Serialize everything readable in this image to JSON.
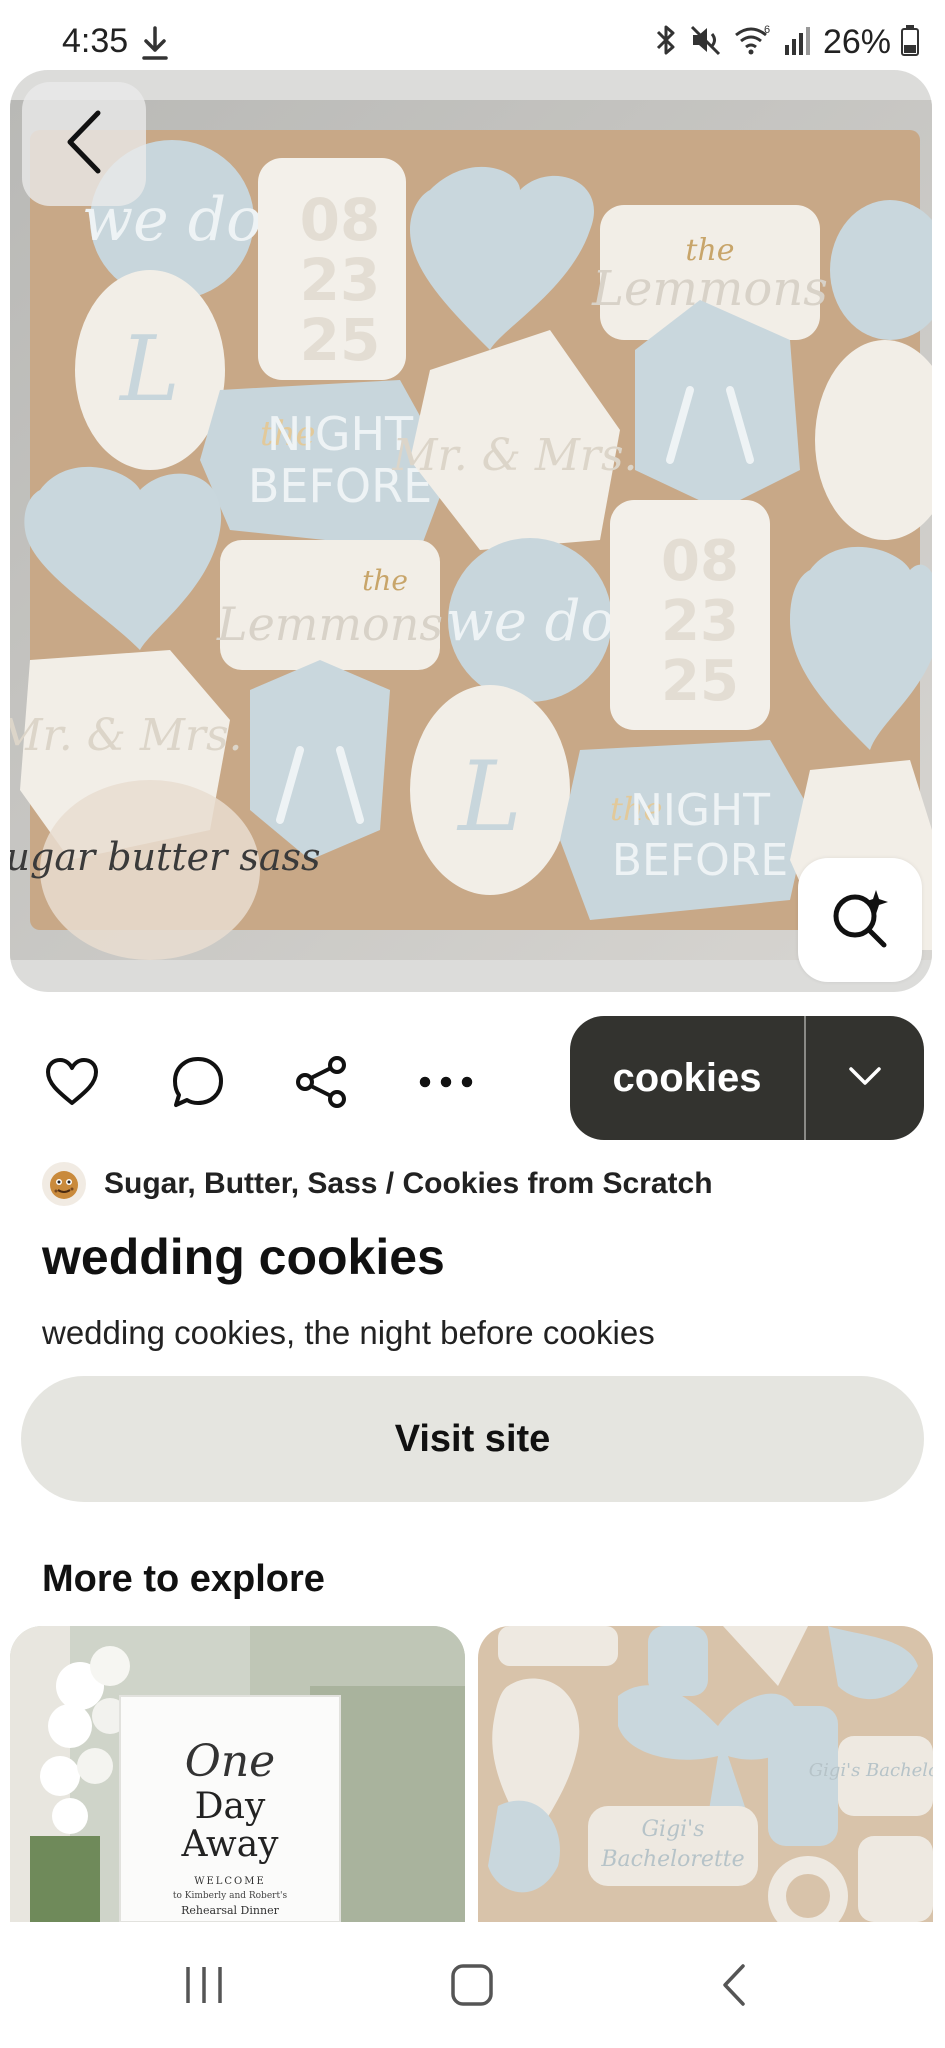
{
  "status_bar": {
    "time": "4:35",
    "battery": "26%",
    "icons": [
      "download-icon",
      "bluetooth-icon",
      "mute-icon",
      "wifi-icon",
      "signal-icon",
      "battery-icon"
    ]
  },
  "hero": {
    "image_subject": "decorated wedding cookies on a tray",
    "cookie_texts": {
      "date": [
        "08",
        "23",
        "25"
      ],
      "night_before_1": "the",
      "night_before_2": "NIGHT",
      "night_before_3": "BEFORE",
      "lemmons_small": "the",
      "lemmons": "Lemmons",
      "we_do": "we do",
      "mr_mrs": "Mr. & Mrs.",
      "initial": "L",
      "watermark": "Sugar butter sass"
    }
  },
  "actions": {
    "like": "heart-icon",
    "comment": "comment-icon",
    "share": "share-icon",
    "more": "more-icon",
    "board_label": "cookies"
  },
  "creator": {
    "name": "Sugar, Butter, Sass / Cookies from Scratch"
  },
  "pin": {
    "title": "wedding cookies",
    "description": "wedding cookies, the night before cookies"
  },
  "visit_button": "Visit site",
  "explore": {
    "heading": "More to explore",
    "thumb1": {
      "sign_line1": "One",
      "sign_line2": "Day",
      "sign_line3": "Away",
      "sign_small1": "WELCOME",
      "sign_small2": "to Kimberly and Robert's",
      "sign_small3": "Rehearsal Dinner"
    },
    "thumb2": {
      "cookie1": "Gigi's Bachelorette",
      "cookie2": "Gigi's",
      "cookie3": "Bachelorette"
    }
  },
  "colors": {
    "pill_bg": "#33332f",
    "visit_bg": "#e5e5e0",
    "cookie_blue": "#c8d6dc",
    "cookie_cream": "#f1ede6"
  }
}
